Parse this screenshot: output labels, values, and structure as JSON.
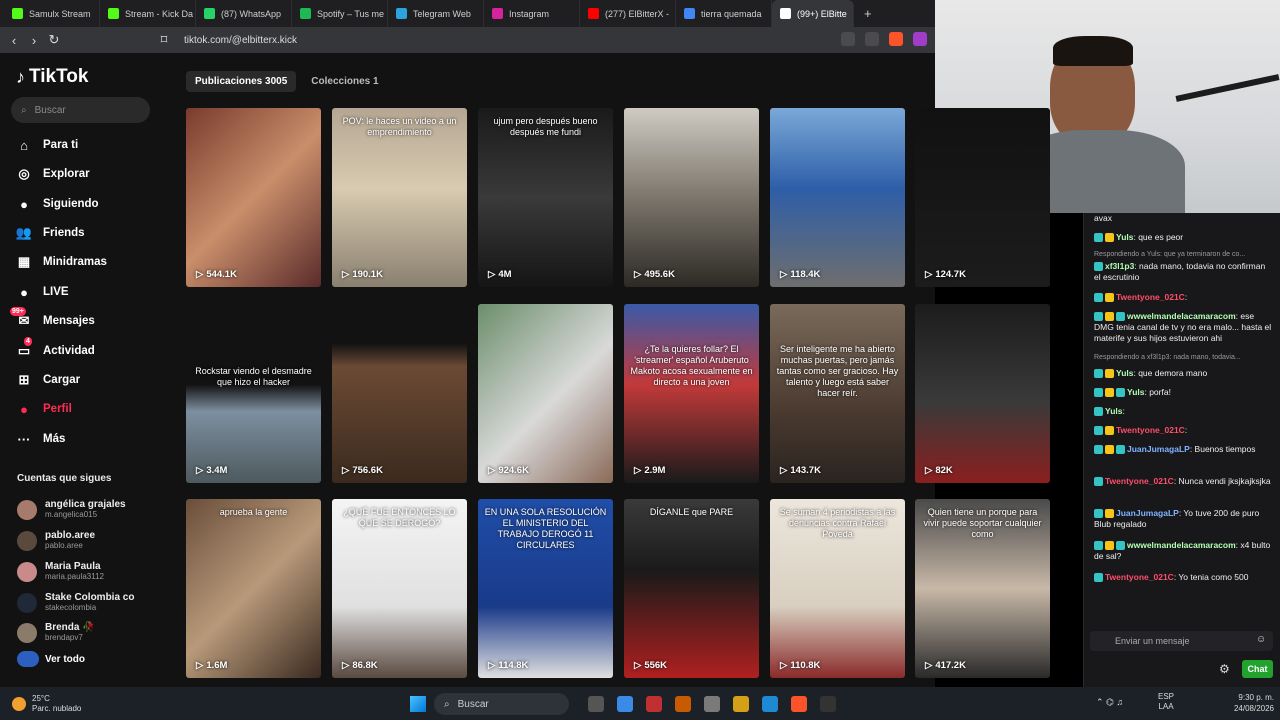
{
  "browser": {
    "tabs": [
      {
        "label": "Samulx Stream",
        "color": "#53fc18",
        "active": false
      },
      {
        "label": "Stream - Kick Da",
        "color": "#53fc18",
        "active": false
      },
      {
        "label": "(87) WhatsApp",
        "color": "#25d366",
        "active": false
      },
      {
        "label": "Spotify – Tus me",
        "color": "#1db954",
        "active": false
      },
      {
        "label": "Telegram Web",
        "color": "#2aa3df",
        "active": false
      },
      {
        "label": "Instagram",
        "color": "#d6249f",
        "active": false
      },
      {
        "label": "(277) ElBitterX -",
        "color": "#ff0000",
        "active": false
      },
      {
        "label": "tierra quemada",
        "color": "#4285f4",
        "active": false
      },
      {
        "label": "(99+) ElBitte",
        "color": "#ffffff",
        "active": true
      }
    ],
    "new_tab": "+",
    "close": "×",
    "url": "tiktok.com/@elbitterx.kick"
  },
  "tiktok": {
    "logo": "TikTok",
    "search_placeholder": "Buscar",
    "nav": [
      {
        "label": "Para ti",
        "icon": "home-icon",
        "glyph": "⌂",
        "color": "#fff"
      },
      {
        "label": "Explorar",
        "icon": "compass-icon",
        "glyph": "◎",
        "color": "#fff"
      },
      {
        "label": "Siguiendo",
        "icon": "avatar-icon",
        "glyph": "●",
        "color": "#fff"
      },
      {
        "label": "Friends",
        "icon": "friends-icon",
        "glyph": "👥",
        "color": "#fff"
      },
      {
        "label": "Minidramas",
        "icon": "film-icon",
        "glyph": "▦",
        "color": "#fff"
      },
      {
        "label": "LIVE",
        "icon": "live-icon",
        "glyph": "●",
        "color": "#fff"
      },
      {
        "label": "Mensajes",
        "icon": "messages-icon",
        "glyph": "✉",
        "color": "#fff",
        "badge": "99+"
      },
      {
        "label": "Actividad",
        "icon": "activity-icon",
        "glyph": "▭",
        "color": "#fff",
        "badge": "4"
      },
      {
        "label": "Cargar",
        "icon": "upload-icon",
        "glyph": "⊞",
        "color": "#fff"
      },
      {
        "label": "Perfil",
        "icon": "profile-icon",
        "glyph": "●",
        "color": "#fe2c55"
      },
      {
        "label": "Más",
        "icon": "more-icon",
        "glyph": "···",
        "color": "#fff"
      }
    ],
    "following_title": "Cuentas que sigues",
    "following": [
      {
        "name": "angélica grajales",
        "handle": "m.angelica015",
        "avatar": "#a67b6b"
      },
      {
        "name": "pablo.aree",
        "handle": "pablo.aree",
        "avatar": "#5a4a3e"
      },
      {
        "name": "Maria Paula",
        "handle": "maria.paula3112",
        "avatar": "#c98a8a"
      },
      {
        "name": "Stake Colombia co",
        "handle": "stakecolombia",
        "avatar": "#1f2937"
      },
      {
        "name": "Brenda 🥀",
        "handle": "brendapv7",
        "avatar": "#8b7b6b"
      }
    ],
    "see_all": "Ver todo",
    "profile_tabs": [
      "Publicaciones 3005",
      "Colecciones 1"
    ],
    "videos": [
      {
        "views": "544.1K",
        "bg": "linear-gradient(135deg,#7a3b2e,#c98e6a 50%,#5a2b2b)",
        "caption": ""
      },
      {
        "views": "190.1K",
        "bg": "linear-gradient(180deg,#b4a692,#d9cbb1 45%,#8a8070)",
        "caption": "POV: le haces un video a un emprendimiento"
      },
      {
        "views": "4M",
        "bg": "linear-gradient(180deg,#1a1a1a,#3a3a3a 50%,#151515)",
        "caption": "ujum pero después bueno después me fundi"
      },
      {
        "views": "495.6K",
        "bg": "linear-gradient(180deg,#cfcbc2,#7c766c 50%,#2d2a25)",
        "caption": ""
      },
      {
        "views": "118.4K",
        "bg": "linear-gradient(180deg,#7aa8d8,#2e5ea8 45%,#6e6e6e)",
        "caption": ""
      },
      {
        "views": "124.7K",
        "bg": "linear-gradient(180deg,#111,#1c1c1c)",
        "caption": ""
      },
      {
        "views": "3.4M",
        "bg": "linear-gradient(180deg,#121212 0%,#121212 45%,#7d8fa0 60%,#4d5a5e)",
        "caption": "Rockstar viendo el desmadre que hizo el hacker"
      },
      {
        "views": "756.6K",
        "bg": "linear-gradient(180deg,#121212 0%,#121212 22%,#6b4a34 35%,#3b2a1e)",
        "caption": ""
      },
      {
        "views": "924.6K",
        "bg": "linear-gradient(135deg,#6b8e6b,#d9d9d9 55%,#8a6a58)",
        "caption": ""
      },
      {
        "views": "2.9M",
        "bg": "linear-gradient(180deg,#3a5aa8,#c23a3a 45%,#1a1a1a)",
        "caption": "¿Te la quieres follar? El 'streamer' español Aruberuto Makoto acosa sexualmente en directo a una joven"
      },
      {
        "views": "143.7K",
        "bg": "linear-gradient(180deg,#7a6a5a,#4a3a30 60%,#2a2420)",
        "caption": "Ser inteligente me ha abierto muchas puertas, pero jamás tantas como ser gracioso. Hay talento y luego está saber hacer reír."
      },
      {
        "views": "82K",
        "bg": "linear-gradient(180deg,#1c1c1c,#3a3a3a 55%,#8a1f1f)",
        "caption": ""
      },
      {
        "views": "1.6M",
        "bg": "linear-gradient(135deg,#6a4e3a,#b89a7a 50%,#3a2a20)",
        "caption": "aprueba la gente"
      },
      {
        "views": "86.8K",
        "bg": "linear-gradient(180deg,#f4f4f4,#e0e0e0 60%,#5a4a40)",
        "caption": "¿QUÉ FUE ENTONCES LO QUE SE DEROGÓ?"
      },
      {
        "views": "114.8K",
        "bg": "linear-gradient(180deg,#1f4ea8,#1a3a8a 60%,#e0e0e0)",
        "caption": "EN UNA SOLA RESOLUCIÓN EL MINISTERIO DEL TRABAJO DEROGÓ 11 CIRCULARES"
      },
      {
        "views": "556K",
        "bg": "linear-gradient(180deg,#3a3a3a,#1a1a1a 40%,#b02020)",
        "caption": "DÍGANLE que PARE"
      },
      {
        "views": "110.8K",
        "bg": "linear-gradient(180deg,#ece6dc,#d8cfc0 60%,#8a2a2a)",
        "caption": "Se suman 4 periodistas a las denuncias contra Rafael Poveda"
      },
      {
        "views": "417.2K",
        "bg": "linear-gradient(180deg,#4a4a4a,#c8b8a8 50%,#2a2a2a)",
        "caption": "Quien tiene un porque para vivir puede soportar cualquier como"
      }
    ]
  },
  "chat": {
    "messages": [
      {
        "user": "",
        "text": "avax",
        "color": "#eee"
      },
      {
        "user": "Yuls",
        "text": ": que es peor",
        "color": "#b3ffb3"
      },
      {
        "user": "",
        "text": "Respondiendo a Yuls: que ya terminaron de co...",
        "color": "#999",
        "system": true
      },
      {
        "user": "xf3l1p3",
        "text": ": nada mano, todavia no confirman el escrutinio",
        "color": "#b3ffb3"
      },
      {
        "user": "Twentyone_021C",
        "text": ":",
        "color": "#ff4d6a"
      },
      {
        "user": "wwwelmandelacamaracom",
        "text": ": ese DMG tenia canal de tv y no era malo... hasta el materife y sus hijos estuvieron ahi",
        "color": "#b3ffb3"
      },
      {
        "user": "",
        "text": "Respondiendo a xf3l1p3: nada mano, todavia...",
        "color": "#999",
        "system": true
      },
      {
        "user": "Yuls",
        "text": ": que demora mano",
        "color": "#b3ffb3"
      },
      {
        "user": "Yuls",
        "text": ": porfa!",
        "color": "#b3ffb3"
      },
      {
        "user": "Yuls",
        "text": ":",
        "color": "#b3ffb3"
      },
      {
        "user": "Twentyone_021C",
        "text": ":",
        "color": "#ff4d6a"
      },
      {
        "user": "JuanJumagaLP",
        "text": ": Buenos tiempos",
        "color": "#7fb3ff"
      },
      {
        "user": "Twentyone_021C",
        "text": ": Nunca vendi jksjkajksjka",
        "color": "#ff4d6a"
      },
      {
        "user": "JuanJumagaLP",
        "text": ": Yo tuve 200 de puro Blub regalado",
        "color": "#7fb3ff"
      },
      {
        "user": "wwwelmandelacamaracom",
        "text": ": x4 bulto de sal?",
        "color": "#b3ffb3"
      },
      {
        "user": "Twentyone_021C",
        "text": ": Yo tenia como 500",
        "color": "#ff4d6a"
      }
    ],
    "input_placeholder": "Enviar un mensaje",
    "send_label": "Chat"
  },
  "taskbar": {
    "temperature": "25°C",
    "weather": "Parc. nublado",
    "search": "Buscar",
    "lang_top": "ESP",
    "lang_bottom": "LAA",
    "time": "9:30 p. m.",
    "date": "24/08/2026"
  }
}
